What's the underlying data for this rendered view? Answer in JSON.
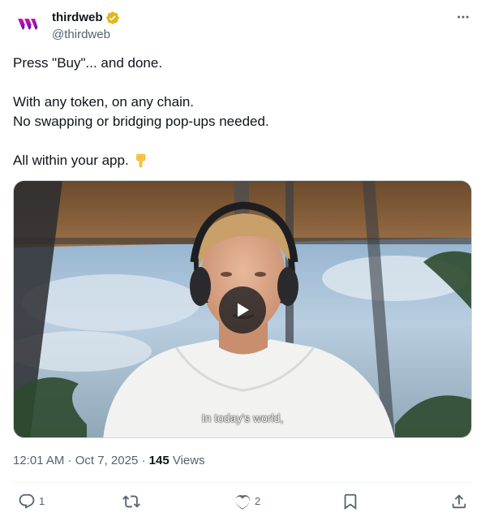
{
  "account": {
    "display_name": "thirdweb",
    "handle": "@thirdweb",
    "verified_icon": "verified-gold-badge-icon",
    "logo_icon": "thirdweb-logo-icon",
    "brand_color": "#f213a4"
  },
  "menu": {
    "more_icon": "more-horizontal-icon"
  },
  "tweet": {
    "line1": "Press \"Buy\"... and done.",
    "line2": "With any token, on any chain.",
    "line3": "No swapping or bridging pop-ups needed.",
    "line4": "All within your app.",
    "line4_emoji": "backhand-index-pointing-down-emoji"
  },
  "media": {
    "type": "video",
    "caption": "In today's world,",
    "play_icon": "play-icon"
  },
  "meta": {
    "time": "12:01 AM",
    "separator": " · ",
    "date": "Oct 7, 2025",
    "views_count": "145",
    "views_label": " Views"
  },
  "actions": {
    "reply_count": "1",
    "retweet_count": "",
    "like_count": "2",
    "bookmark_count": "",
    "reply_icon": "reply-icon",
    "retweet_icon": "retweet-icon",
    "like_icon": "heart-icon",
    "bookmark_icon": "bookmark-icon",
    "share_icon": "share-icon"
  },
  "colors": {
    "text_primary": "#0f1419",
    "text_secondary": "#536471",
    "verified_gold": "#e2b719"
  }
}
